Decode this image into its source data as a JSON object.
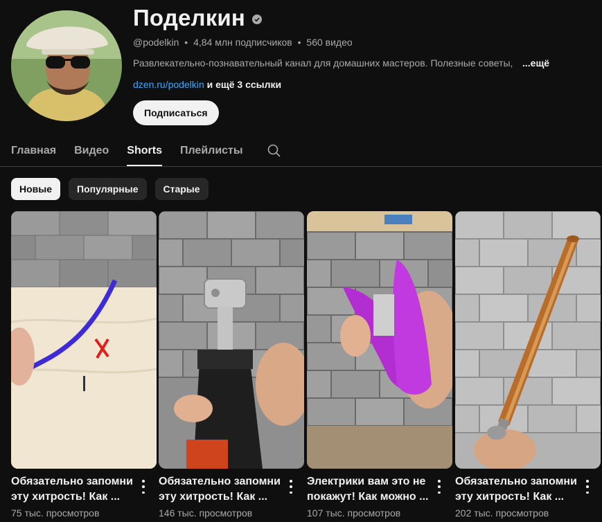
{
  "channel": {
    "name": "Поделкин",
    "handle": "@podelkin",
    "subscribers": "4,84 млн подписчиков",
    "videos": "560 видео",
    "separator": "•",
    "description": "Развлекательно-познавательный канал для домашних мастеров. Полезные советы,",
    "description_more": "...ещё",
    "link": "dzen.ru/podelkin",
    "more_links": "и ещё 3 ссылки",
    "subscribe_label": "Подписаться"
  },
  "tabs": [
    {
      "label": "Главная",
      "active": false
    },
    {
      "label": "Видео",
      "active": false
    },
    {
      "label": "Shorts",
      "active": true
    },
    {
      "label": "Плейлисты",
      "active": false
    }
  ],
  "chips": [
    {
      "label": "Новые",
      "active": true
    },
    {
      "label": "Популярные",
      "active": false
    },
    {
      "label": "Старые",
      "active": false
    }
  ],
  "shorts": [
    {
      "title": "Обязательно запомни эту хитрость! Как ...",
      "views": "75 тыс. просмотров"
    },
    {
      "title": "Обязательно запомни эту хитрость! Как ...",
      "views": "146 тыс. просмотров"
    },
    {
      "title": "Электрики вам это не покажут! Как можно ...",
      "views": "107 тыс. просмотров"
    },
    {
      "title": "Обязательно запомни эту хитрость! Как ...",
      "views": "202 тыс. просмотров"
    }
  ],
  "icons": {
    "verified": "verified-check-icon",
    "search": "search-icon",
    "menu": "more-vertical-icon"
  },
  "colors": {
    "background": "#0f0f0f",
    "text": "#f1f1f1",
    "secondary_text": "#aaaaaa",
    "link": "#3ea6ff",
    "chip": "#272727"
  }
}
